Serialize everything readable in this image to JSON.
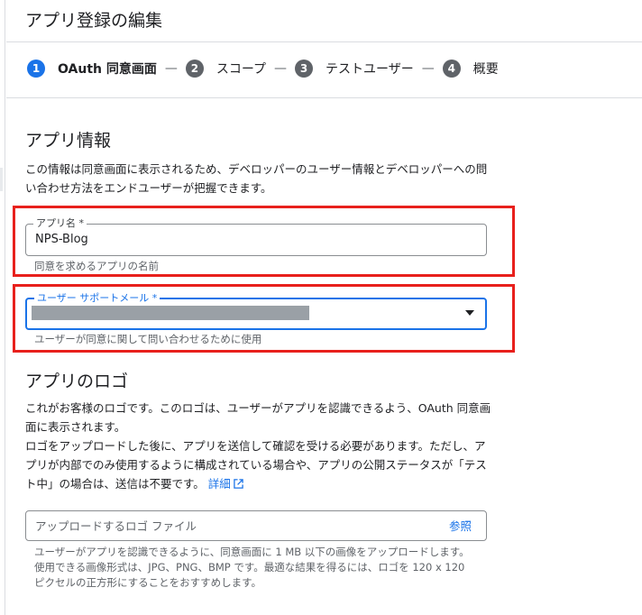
{
  "page": {
    "title": "アプリ登録の編集"
  },
  "stepper": {
    "steps": [
      {
        "num": "1",
        "label": "OAuth 同意画面",
        "active": true
      },
      {
        "num": "2",
        "label": "スコープ",
        "active": false
      },
      {
        "num": "3",
        "label": "テストユーザー",
        "active": false
      },
      {
        "num": "4",
        "label": "概要",
        "active": false
      }
    ],
    "separator": "—"
  },
  "app_info": {
    "heading": "アプリ情報",
    "description": "この情報は同意画面に表示されるため、デベロッパーのユーザー情報とデベロッパーへの問い合わせ方法をエンドユーザーが把握できます。",
    "app_name": {
      "label": "アプリ名 *",
      "value": "NPS-Blog",
      "hint": "同意を求めるアプリの名前"
    },
    "support_email": {
      "label": "ユーザー サポートメール *",
      "hint": "ユーザーが同意に関して問い合わせるために使用"
    }
  },
  "logo": {
    "heading": "アプリのロゴ",
    "para1": "これがお客様のロゴです。このロゴは、ユーザーがアプリを認識できるよう、OAuth 同意画面に表示されます。",
    "para2": "ロゴをアップロードした後に、アプリを送信して確認を受ける必要があります。ただし、アプリが内部でのみ使用するように構成されている場合や、アプリの公開ステータスが「テスト中」の場合は、送信は不要です。",
    "link_label": "詳細",
    "upload_placeholder": "アップロードするロゴ ファイル",
    "browse_label": "参照",
    "hint": "ユーザーがアプリを認識できるように、同意画面に 1 MB 以下の画像をアップロードします。使用できる画像形式は、JPG、PNG、BMP です。最適な結果を得るには、ロゴを 120 x 120 ピクセルの正方形にすることをおすすめします。"
  },
  "colors": {
    "accent": "#1a73e8",
    "highlight": "#e8201c"
  }
}
